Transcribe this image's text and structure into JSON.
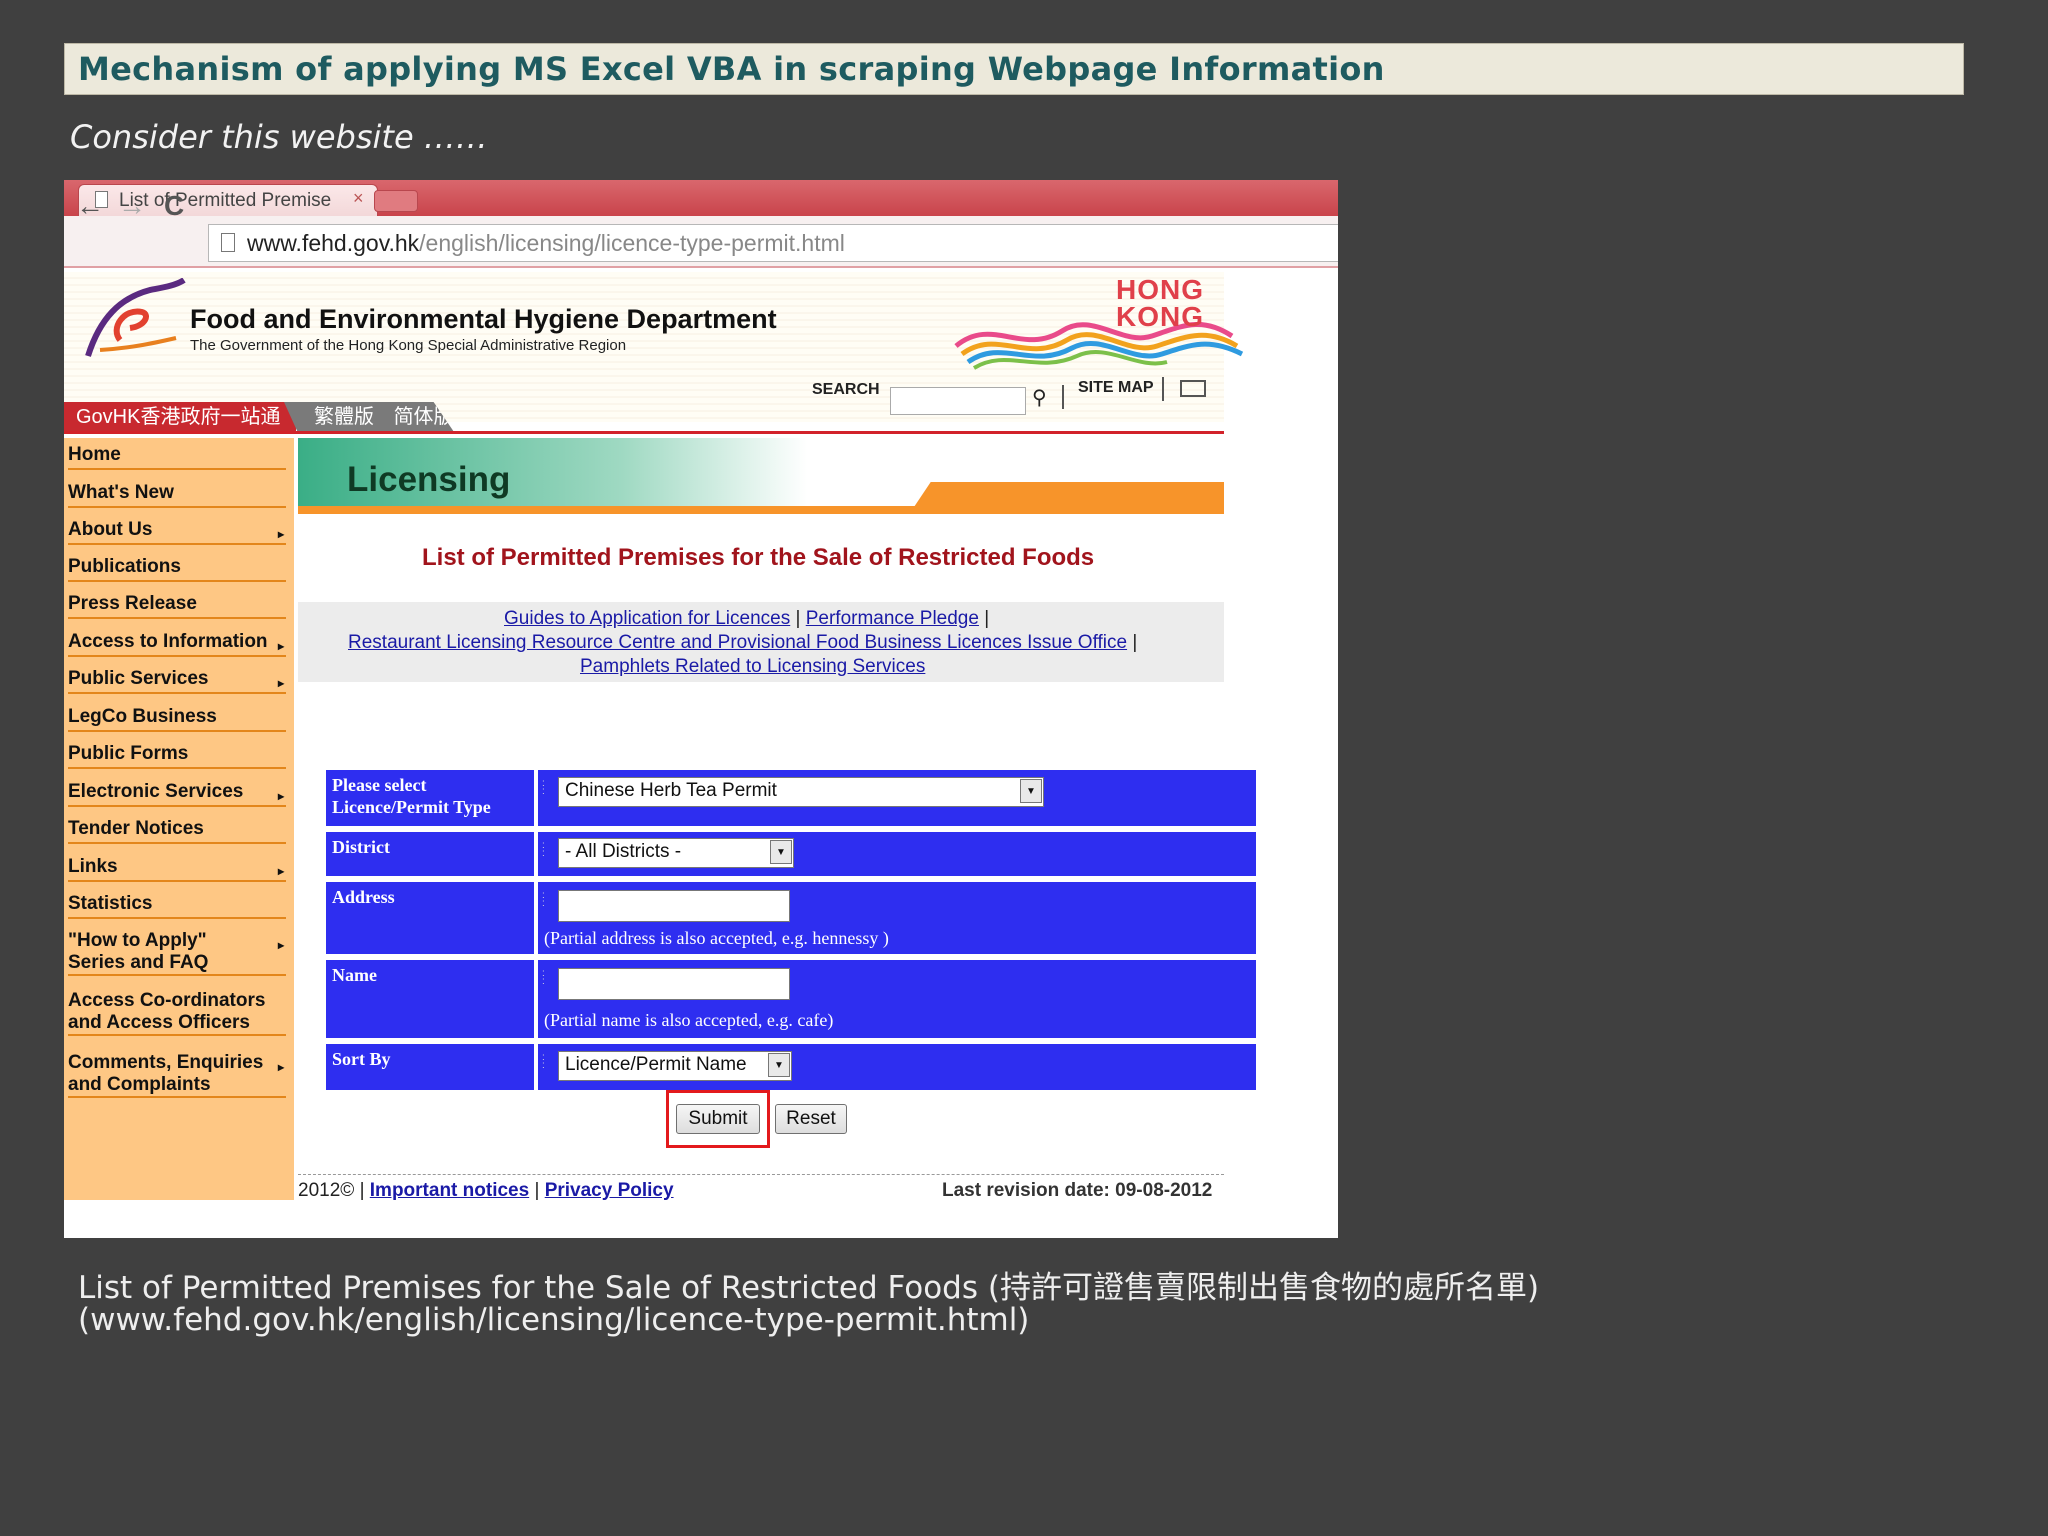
{
  "slide": {
    "title": "Mechanism of applying MS Excel VBA in scraping Webpage Information",
    "subtitle": "Consider this website ……",
    "caption_line1": "List of Permitted Premises for the Sale of Restricted Foods (持許可證售賣限制出售食物的處所名單)",
    "caption_line2": "(www.fehd.gov.hk/english/licensing/licence-type-permit.html)"
  },
  "browser": {
    "tab_title": "List of Permitted Premise",
    "tab_close": "×",
    "url_host": "www.fehd.gov.hk",
    "url_path": "/english/licensing/licence-type-permit.html",
    "back_icon": "←",
    "forward_icon": "→",
    "reload_icon": "C"
  },
  "header": {
    "dept_name": "Food and Environmental Hygiene Department",
    "dept_sub": "The Government of the Hong Kong Special Administrative Region",
    "hk_line1": "HONG",
    "hk_line2": "KONG",
    "search_label": "SEARCH",
    "search_icon": "⚲",
    "sitemap": "SITE MAP",
    "govhk": "GovHK香港政府一站通",
    "lang_trad": "繁體版",
    "lang_simp": "简体版"
  },
  "sidebar": {
    "items": [
      {
        "label": "Home",
        "arrow": ""
      },
      {
        "label": "What's New",
        "arrow": ""
      },
      {
        "label": "About Us",
        "arrow": "▸"
      },
      {
        "label": "Publications",
        "arrow": ""
      },
      {
        "label": "Press Release",
        "arrow": ""
      },
      {
        "label": "Access to Information",
        "arrow": "▸"
      },
      {
        "label": "Public Services",
        "arrow": "▸"
      },
      {
        "label": "LegCo Business",
        "arrow": ""
      },
      {
        "label": "Public Forms",
        "arrow": ""
      },
      {
        "label": "Electronic Services",
        "arrow": "▸"
      },
      {
        "label": "Tender Notices",
        "arrow": ""
      },
      {
        "label": "Links",
        "arrow": "▸"
      },
      {
        "label": "Statistics",
        "arrow": ""
      },
      {
        "label": "\"How to Apply\"",
        "label2": "Series and FAQ",
        "arrow": "▸"
      },
      {
        "label": "Access Co-ordinators",
        "label2": "and Access Officers",
        "arrow": ""
      },
      {
        "label": "Comments, Enquiries",
        "label2": "and Complaints",
        "arrow": "▸"
      }
    ]
  },
  "main": {
    "banner_title": "Licensing",
    "heading": "List of Permitted Premises for the Sale of Restricted Foods",
    "links": {
      "guides": "Guides to Application for Licences",
      "pledge": "Performance Pledge",
      "restaurant": "Restaurant Licensing Resource Centre and Provisional Food Business Licences Issue Office",
      "pamphlets": "Pamphlets Related to Licensing Services",
      "sep": "|"
    }
  },
  "form": {
    "type_label_1": "Please select",
    "type_label_2": "Licence/Permit Type",
    "type_value": "Chinese Herb Tea Permit",
    "district_label": "District",
    "district_value": "- All Districts -",
    "address_label": "Address",
    "address_value": "",
    "address_hint": "(Partial address is also accepted, e.g. hennessy )",
    "name_label": "Name",
    "name_value": "",
    "name_hint": "(Partial name is also accepted, e.g. cafe)",
    "sort_label": "Sort By",
    "sort_value": "Licence/Permit Name",
    "submit": "Submit",
    "reset": "Reset",
    "dropdown_icon": "▼"
  },
  "footer": {
    "year": "2012",
    "copyright_icon": "©",
    "sep": "|",
    "important": "Important notices",
    "privacy": "Privacy Policy",
    "revision": "Last revision date: 09-08-2012"
  },
  "colors": {
    "form_blue": "#2e2ef0",
    "sidebar_orange": "#fec784",
    "heading_red": "#a1141c",
    "highlight_red": "#e3191c"
  }
}
